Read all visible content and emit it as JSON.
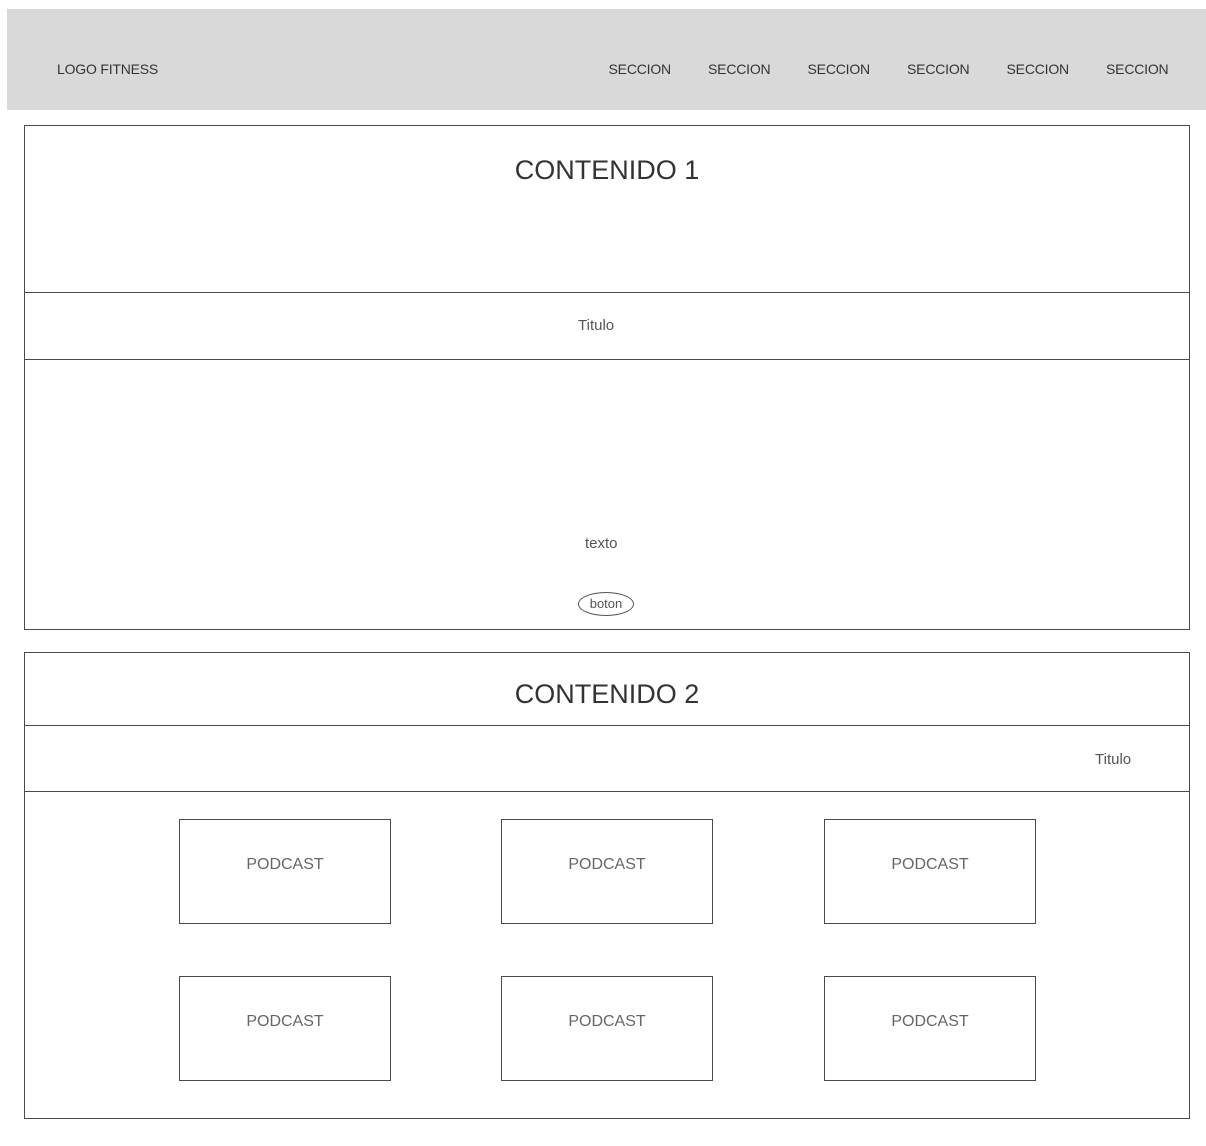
{
  "header": {
    "logo": "LOGO FITNESS",
    "nav": [
      {
        "label": "SECCION"
      },
      {
        "label": "SECCION"
      },
      {
        "label": "SECCION"
      },
      {
        "label": "SECCION"
      },
      {
        "label": "SECCION"
      },
      {
        "label": "SECCION"
      }
    ]
  },
  "content1": {
    "title": "CONTENIDO 1",
    "subtitle": "Titulo",
    "text": "texto",
    "button": "boton"
  },
  "content2": {
    "title": "CONTENIDO 2",
    "subtitle": "Titulo",
    "podcasts": [
      {
        "label": "PODCAST"
      },
      {
        "label": "PODCAST"
      },
      {
        "label": "PODCAST"
      },
      {
        "label": "PODCAST"
      },
      {
        "label": "PODCAST"
      },
      {
        "label": "PODCAST"
      }
    ]
  },
  "colors": {
    "header_bg": "#d9d9d9",
    "border": "#4a4a4a"
  }
}
